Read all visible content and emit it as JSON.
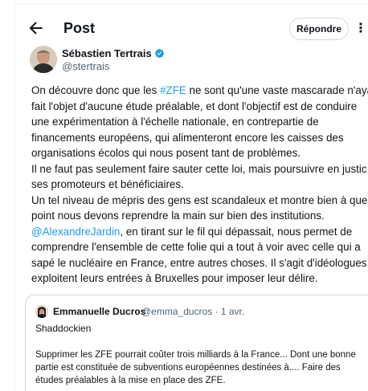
{
  "header": {
    "title": "Post",
    "reply_label": "Répondre",
    "more_label": "⋮"
  },
  "author": {
    "name": "Sébastien Tertrais",
    "handle": "@stertrais"
  },
  "post": {
    "lines": [
      [
        "On découvre donc que les ",
        "#ZFE",
        " ne sont qu'une vaste mascarade n'aya"
      ],
      "fait l'objet d'aucune étude préalable, et dont l'objectif est de conduire",
      "une expérimentation à l'échelle nationale, en contrepartie de",
      "financements européens, qui alimenteront encore les caisses des",
      "organisations écolos qui nous posent tant de problèmes.",
      "Il ne faut pas seulement faire sauter cette loi, mais poursuivre en justic",
      "ses promoteurs et bénéficiaires.",
      "Un tel niveau de mépris des gens est scandaleux et montre bien à quel",
      "point nous devons reprendre la main sur bien des institutions.",
      [
        "",
        "@AlexandreJardin",
        ", en tirant sur le fil qui dépassait, nous permet de"
      ],
      "comprendre l'ensemble de cette folie qui a tout à voir avec celle qui a",
      "sapé le nucléaire en France, entre autres choses. Il s'agit d'idéologues q",
      "exploitent leurs entrées à Bruxelles pour imposer leur délire."
    ]
  },
  "quote": {
    "name": "Emmanuelle Ducros",
    "handle_date": "@emma_ducros · 1 avr.",
    "subtitle": "Shaddockien",
    "lines": [
      "Supprimer les ZFE pourrait coûter trois milliards à la France... Dont une bonne",
      "partie est constituée de subventions européennes destinées à.... Faire des",
      "études préalables à la mise en place des ZFE."
    ]
  },
  "colors": {
    "link": "#1d9bf0",
    "verified": "#1d9bf0",
    "secondary_text": "#536471",
    "border": "#cfd9de"
  },
  "icons": {
    "back": "back-arrow-icon",
    "verified": "verified-badge-icon",
    "more": "more-vertical-icon"
  }
}
